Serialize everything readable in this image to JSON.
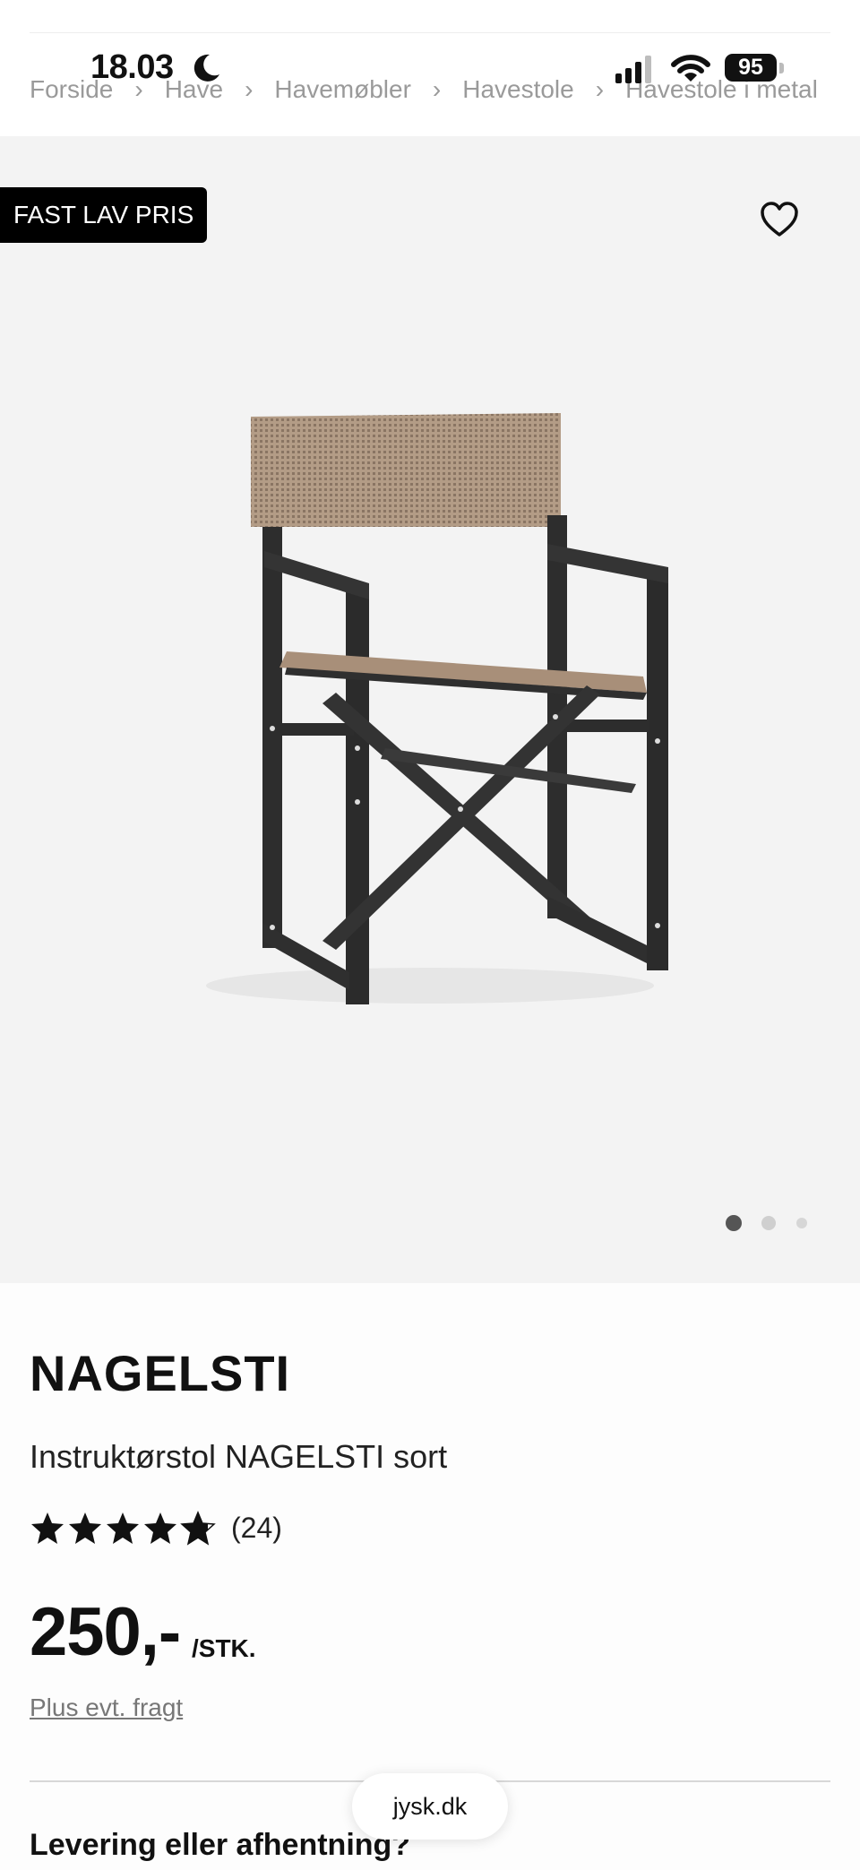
{
  "status_bar": {
    "time": "18.03",
    "battery": "95"
  },
  "breadcrumb": {
    "items": [
      "Forside",
      "Have",
      "Havemøbler",
      "Havestole",
      "Havestole i metal"
    ],
    "separator": "›"
  },
  "hero": {
    "badge": "FAST LAV PRIS",
    "image_count": 3,
    "active_image": 1,
    "icons": {
      "favorite": "heart-outline-icon"
    }
  },
  "product": {
    "name": "NAGELSTI",
    "description": "Instruktørstol NAGELSTI sort",
    "rating": 4.8,
    "rating_max": 5,
    "reviews": "(24)",
    "price": "250,-",
    "unit": "/STK.",
    "freight": "Plus evt. fragt"
  },
  "delivery": {
    "title": "Levering eller afhentning?"
  },
  "browser": {
    "url": "jysk.dk"
  },
  "colors": {
    "badge_bg": "#000000",
    "hero_bg": "#f3f3f3",
    "star": "#111111"
  }
}
